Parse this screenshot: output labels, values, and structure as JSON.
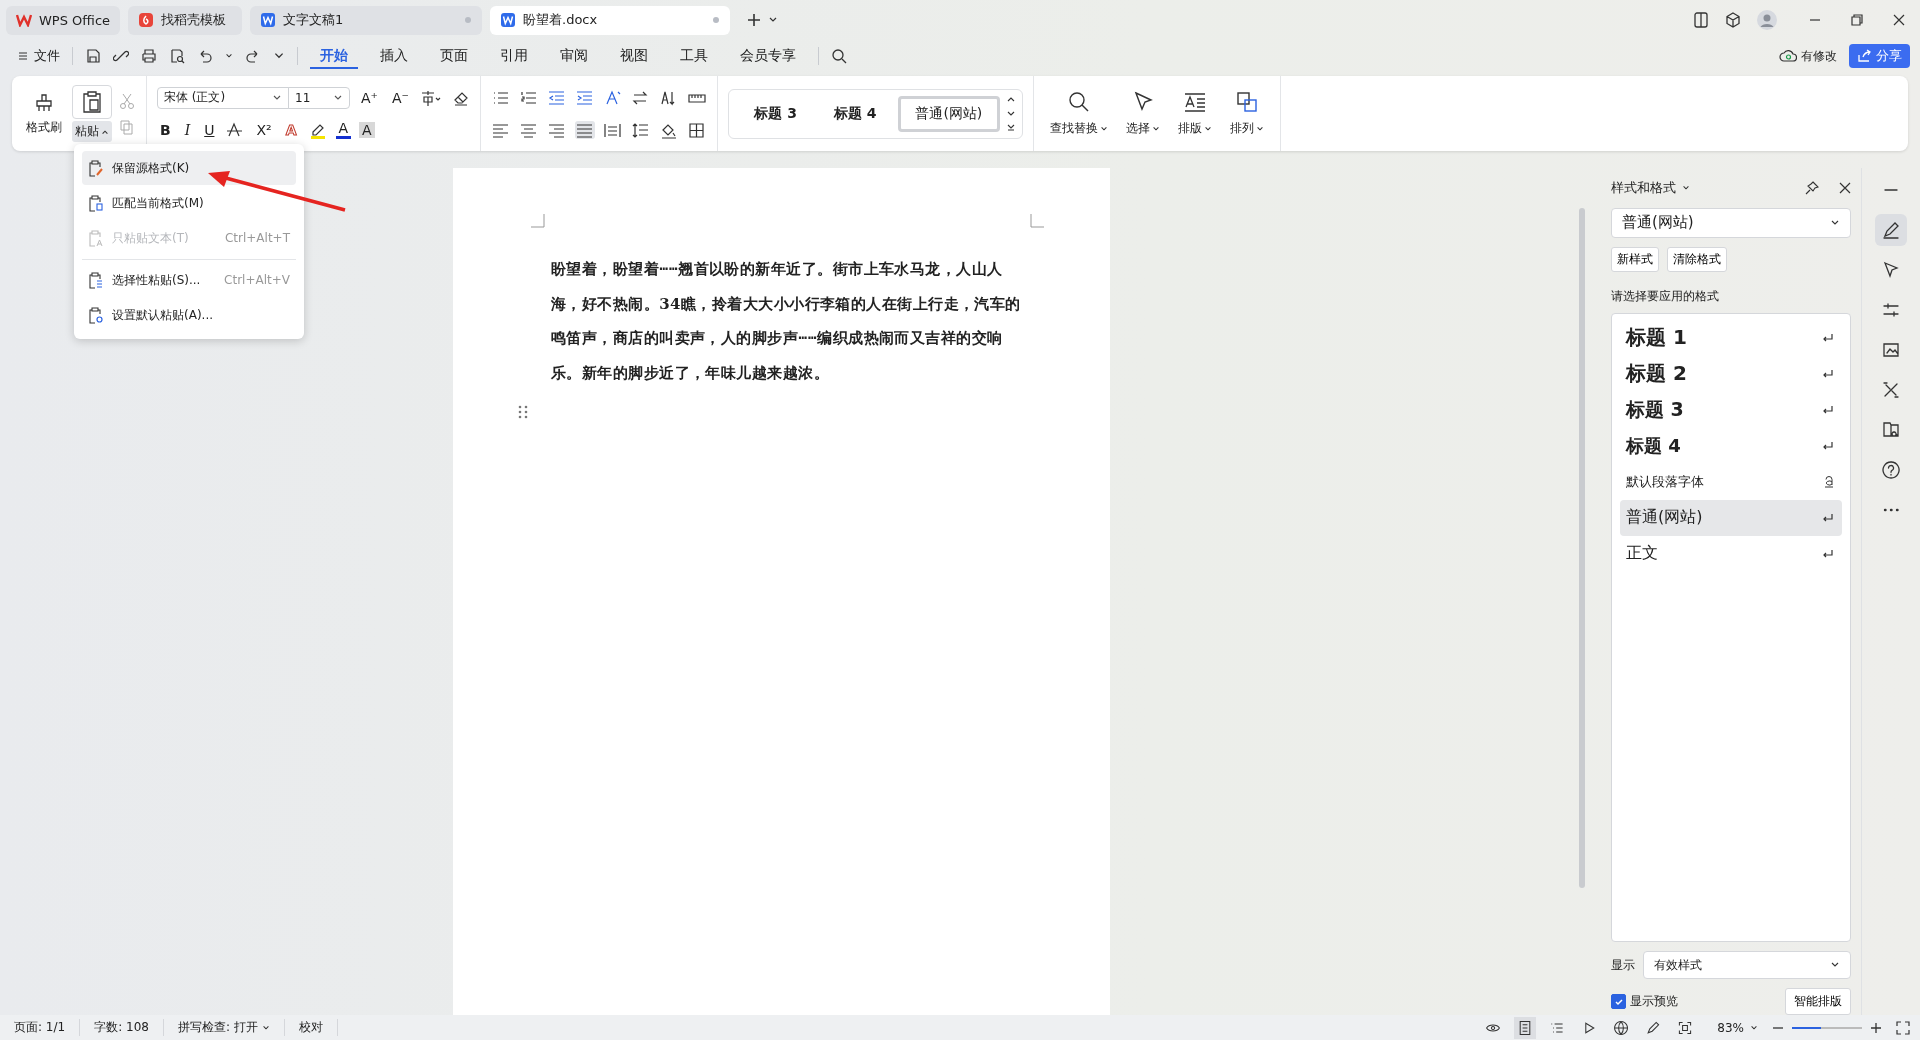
{
  "window_tabs": [
    {
      "label": "WPS Office",
      "kind": "home",
      "selected": false
    },
    {
      "label": "找稻壳模板",
      "kind": "template",
      "selected": false
    },
    {
      "label": "文字文稿1",
      "kind": "doc",
      "selected": false
    },
    {
      "label": "盼望着.docx",
      "kind": "doc",
      "selected": true
    }
  ],
  "menu": {
    "file": "文件",
    "tabs": [
      {
        "label": "开始",
        "selected": true
      },
      {
        "label": "插入",
        "selected": false
      },
      {
        "label": "页面",
        "selected": false
      },
      {
        "label": "引用",
        "selected": false
      },
      {
        "label": "审阅",
        "selected": false
      },
      {
        "label": "视图",
        "selected": false
      },
      {
        "label": "工具",
        "selected": false
      },
      {
        "label": "会员专享",
        "selected": false
      }
    ],
    "save_status": "有修改",
    "share": "分享"
  },
  "ribbon": {
    "format_painter": "格式刷",
    "paste": "粘贴",
    "paste_open": true,
    "font": "宋体 (正文)",
    "size": "11",
    "font_buttons": [
      {
        "label": "A⁺"
      },
      {
        "label": "A⁻"
      }
    ],
    "format_buttons": [
      {
        "label": "B",
        "kind": "bold"
      },
      {
        "label": "I",
        "kind": "italic"
      },
      {
        "label": "U",
        "kind": "underline"
      }
    ],
    "script_button": "X²",
    "effect_buttons": [
      {
        "label": "A",
        "kind": "effect"
      },
      {
        "label": "A",
        "kind": "color"
      },
      {
        "label": "A",
        "kind": "shade"
      }
    ],
    "styles": [
      {
        "label": "标题 3",
        "selected": false
      },
      {
        "label": "标题 4",
        "selected": false
      },
      {
        "label": "普通(网站)",
        "selected": true
      }
    ],
    "tools": [
      "查找替换",
      "选择",
      "排版",
      "排列"
    ]
  },
  "paste_menu": [
    {
      "label": "保留源格式(K)",
      "kind": "keep",
      "selected": true,
      "disabled": false,
      "divider_before": false
    },
    {
      "label": "匹配当前格式(M)",
      "kind": "match",
      "selected": false,
      "disabled": false,
      "divider_before": false
    },
    {
      "label": "只粘贴文本(T)",
      "shortcut": "Ctrl+Alt+T",
      "kind": "text",
      "selected": false,
      "disabled": true,
      "divider_before": false
    },
    {
      "label": "选择性粘贴(S)...",
      "shortcut": "Ctrl+Alt+V",
      "kind": "special",
      "selected": false,
      "disabled": false,
      "divider_before": true
    },
    {
      "label": "设置默认粘贴(A)...",
      "kind": "default",
      "selected": false,
      "disabled": false,
      "divider_before": false
    }
  ],
  "document": {
    "paragraph": "盼望着，盼望着┅┅翘首以盼的新年近了。街市上车水马龙，人山人海，好不热闹。34瞧，拎着大大小小行李箱的人在街上行走，汽车的鸣笛声，商店的叫卖声，人的脚步声┅┅编织成热闹而又吉祥的交响乐。新年的脚步近了，年味儿越来越浓。"
  },
  "styles_panel": {
    "title": "样式和格式",
    "current": "普通(网站)",
    "buttons": [
      "新样式",
      "清除格式"
    ],
    "prompt": "请选择要应用的格式",
    "styles": [
      {
        "label": "标题 1",
        "kind": "heading1",
        "selected": false
      },
      {
        "label": "标题 2",
        "kind": "heading2",
        "selected": false
      },
      {
        "label": "标题 3",
        "kind": "heading3",
        "selected": false
      },
      {
        "label": "标题 4",
        "kind": "heading4",
        "selected": false
      },
      {
        "label": "默认段落字体",
        "kind": "font",
        "selected": false
      },
      {
        "label": "普通(网站)",
        "kind": "body",
        "selected": true
      },
      {
        "label": "正文",
        "kind": "body",
        "selected": false
      }
    ],
    "show_label": "显示",
    "show_value": "有效样式",
    "preview": {
      "label": "显示预览",
      "checked": true
    },
    "smart_button": "智能排版"
  },
  "status_bar": {
    "items": [
      "页面: 1/1",
      "字数: 108",
      "拼写检查: 打开",
      "校对"
    ],
    "zoom": "83%",
    "zoom_slider": {
      "level": 0.42
    }
  }
}
